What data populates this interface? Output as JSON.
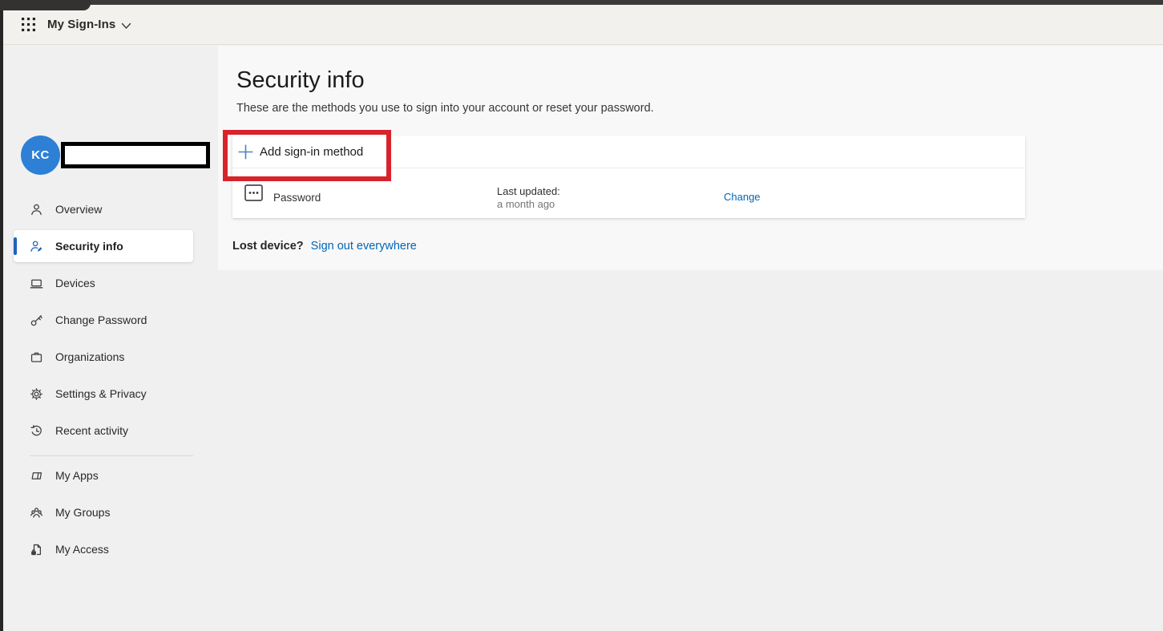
{
  "chrome": {
    "app_title": "My Sign-Ins"
  },
  "sidebar": {
    "avatar_initials": "KC",
    "items": [
      {
        "label": "Overview",
        "icon": "person-icon",
        "selected": false
      },
      {
        "label": "Security info",
        "icon": "person-edit-icon",
        "selected": true
      },
      {
        "label": "Devices",
        "icon": "laptop-icon",
        "selected": false
      },
      {
        "label": "Change Password",
        "icon": "key-icon",
        "selected": false
      },
      {
        "label": "Organizations",
        "icon": "briefcase-icon",
        "selected": false
      },
      {
        "label": "Settings & Privacy",
        "icon": "gear-icon",
        "selected": false
      },
      {
        "label": "Recent activity",
        "icon": "history-icon",
        "selected": false
      }
    ],
    "secondary_items": [
      {
        "label": "My Apps",
        "icon": "apps-icon"
      },
      {
        "label": "My Groups",
        "icon": "people-icon"
      },
      {
        "label": "My Access",
        "icon": "document-lock-icon"
      }
    ]
  },
  "main": {
    "title": "Security info",
    "subtitle": "These are the methods you use to sign into your account or reset your password.",
    "add_method_label": "Add sign-in method",
    "methods": [
      {
        "name": "Password",
        "updated_label": "Last updated:",
        "updated_value": "a month ago",
        "action_label": "Change"
      }
    ],
    "footer": {
      "lost_device_label": "Lost device?",
      "signout_label": "Sign out everywhere"
    }
  },
  "colors": {
    "link_blue": "#0067b8",
    "plus_blue": "#4d82c4",
    "avatar_blue": "#2d80d6",
    "selected_accent": "#1e63bd",
    "annotation_red": "#d8232a",
    "appbar_bg": "#f3f1ee",
    "sidebar_bg": "#f0f0f0",
    "main_bg": "#f8f8f8"
  }
}
